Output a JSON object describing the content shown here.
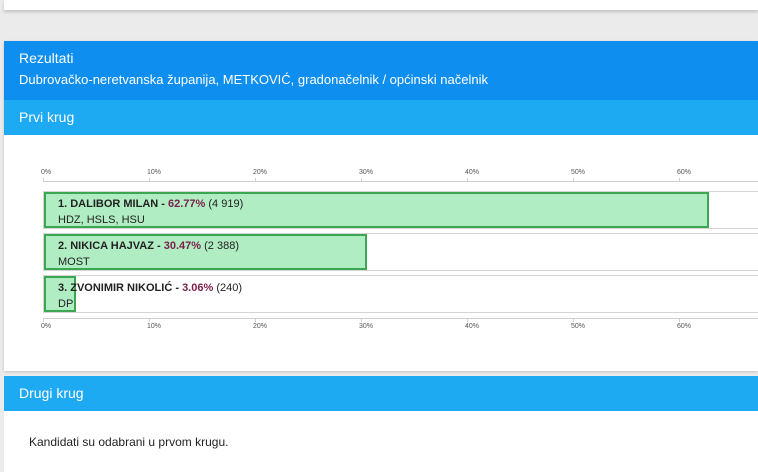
{
  "results": {
    "title": "Rezultati",
    "subtitle": "Dubrovačko-neretvanska županija, METKOVIĆ, gradonačelnik / općinski načelnik"
  },
  "round1": {
    "title": "Prvi krug"
  },
  "chart_data": {
    "type": "bar",
    "orientation": "horizontal",
    "xlim": [
      0,
      67
    ],
    "ticks": [
      "0%",
      "10%",
      "20%",
      "30%",
      "40%",
      "50%",
      "60%"
    ],
    "candidates": [
      {
        "label": "1. DALIBOR MILAN",
        "percent_text": "62.77%",
        "value": 62.77,
        "votes": "(4 919)",
        "party": "HDZ, HSLS, HSU"
      },
      {
        "label": "2. NIKICA HAJVAZ",
        "percent_text": "30.47%",
        "value": 30.47,
        "votes": "(2 388)",
        "party": "MOST"
      },
      {
        "label": "3. ZVONIMIR NIKOLIĆ",
        "percent_text": "3.06%",
        "value": 3.06,
        "votes": "(240)",
        "party": "DP"
      }
    ],
    "colors": {
      "bar_fill": "#b1edc3",
      "bar_border": "#3ca653",
      "percent": "#7b1e4b"
    }
  },
  "round2": {
    "title": "Drugi krug",
    "note": "Kandidati su odabrani u prvom krugu."
  }
}
